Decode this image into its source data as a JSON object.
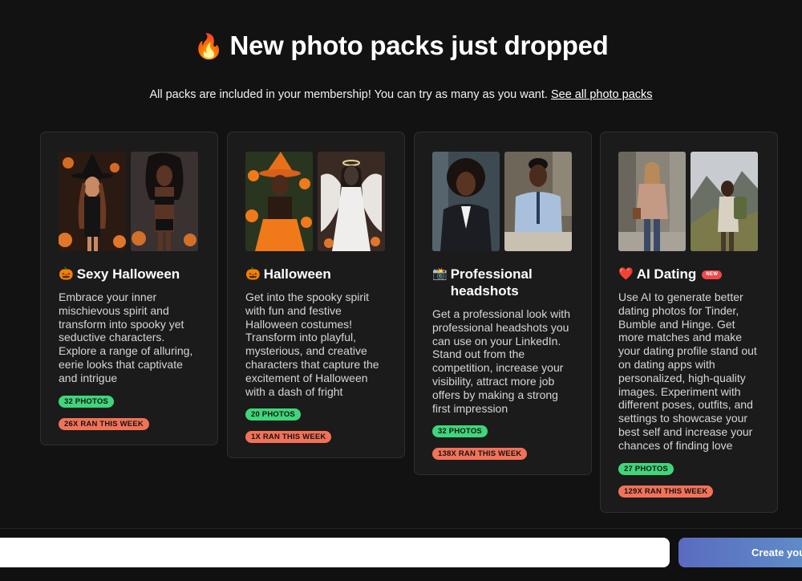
{
  "header": {
    "fire_icon": "🔥",
    "title": "New photo packs just dropped",
    "subtitle": "All packs are included in your membership! You can try as many as you want.",
    "see_all_link": "See all photo packs"
  },
  "packs": [
    {
      "emoji": "🎃",
      "title": "Sexy Halloween",
      "description": "Embrace your inner mischievous spirit and transform into spooky yet seductive characters. Explore a range of alluring, eerie looks that captivate and intrigue",
      "photos_label": "32 PHOTOS",
      "ran_label": "26X RAN THIS WEEK",
      "photos": [
        {
          "name": "witch-costume-photo",
          "bg": "#3a2418",
          "accent": "#e0762a"
        },
        {
          "name": "lingerie-costume-photo",
          "bg": "#2a2522",
          "accent": "#c96a2a"
        }
      ]
    },
    {
      "emoji": "🎃",
      "title": "Halloween",
      "description": "Get into the spooky spirit with fun and festive Halloween costumes! Transform into playful, mysterious, and creative characters that capture the excitement of Halloween with a dash of fright",
      "photos_label": "20 PHOTOS",
      "ran_label": "1X RAN THIS WEEK",
      "photos": [
        {
          "name": "orange-witch-photo",
          "bg": "#2e3a1e",
          "accent": "#f07a1a"
        },
        {
          "name": "angel-costume-photo",
          "bg": "#3a2a22",
          "accent": "#e8e4e0"
        }
      ]
    },
    {
      "emoji": "📸",
      "title": "Professional headshots",
      "description": "Get a professional look with professional headshots you can use on your LinkedIn. Stand out from the competition, increase your visibility, attract more job offers by making a strong first impression",
      "photos_label": "32 PHOTOS",
      "ran_label": "138X RAN THIS WEEK",
      "photos": [
        {
          "name": "businesswoman-headshot-photo",
          "bg": "#4a5560",
          "accent": "#222428"
        },
        {
          "name": "businessman-headshot-photo",
          "bg": "#8a8070",
          "accent": "#a8c0dc"
        }
      ]
    },
    {
      "emoji": "❤️",
      "title": "AI Dating",
      "badge": "NEW",
      "description": "Use AI to generate better dating photos for Tinder, Bumble and Hinge. Get more matches and make your dating profile stand out on dating apps with personalized, high-quality images. Experiment with different poses, outfits, and settings to showcase your best self and increase your chances of finding love",
      "photos_label": "27 PHOTOS",
      "ran_label": "129X RAN THIS WEEK",
      "photos": [
        {
          "name": "city-street-dating-photo",
          "bg": "#8a8680",
          "accent": "#c49a84"
        },
        {
          "name": "mountain-hike-dating-photo",
          "bg": "#9aa2a6",
          "accent": "#6a7a4a"
        }
      ]
    }
  ],
  "footer": {
    "input_placeholder": "",
    "create_button_label": "Create you"
  }
}
